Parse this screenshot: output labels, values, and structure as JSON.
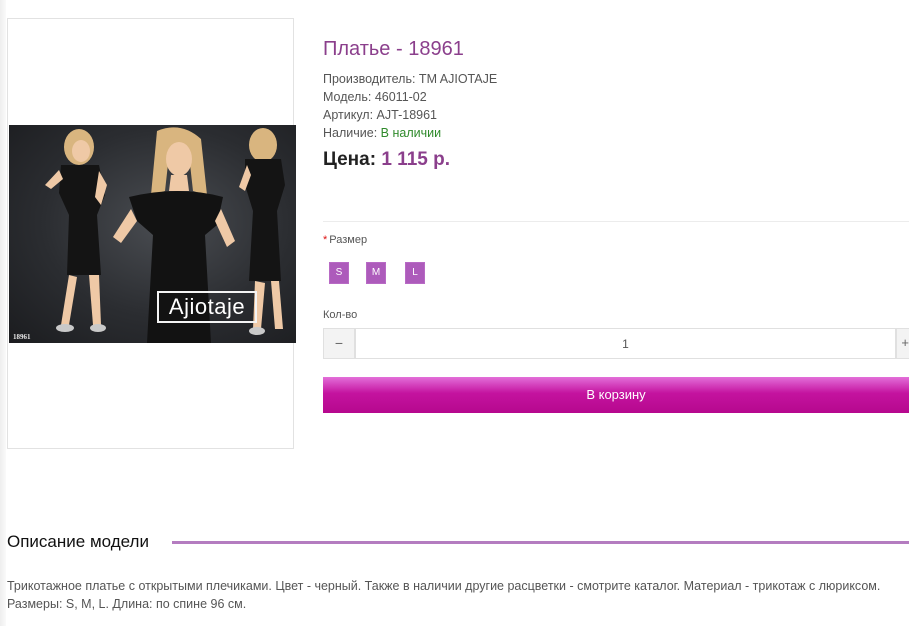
{
  "product": {
    "image": {
      "brand_logo_text": "Ajiotaje",
      "sku_tag": "18961"
    },
    "title": "Платье - 18961",
    "info": {
      "manufacturer": "Производитель: TM AJIOTAJE",
      "model": "Модель: 46011-02",
      "article": "Артикул: AJT-18961",
      "availability_label": "Наличие: ",
      "availability_value": "В наличии"
    },
    "price": {
      "label": "Цена: ",
      "value": "1 115 р."
    }
  },
  "options": {
    "size": {
      "required_mark": "*",
      "label": "Размер",
      "values": [
        "S",
        "M",
        "L"
      ]
    },
    "quantity": {
      "label": "Кол-во",
      "value": "1",
      "minus": "−",
      "plus": "+"
    }
  },
  "actions": {
    "add_to_cart": "В корзину"
  },
  "description": {
    "title": "Описание модели",
    "text": "Трикотажное платье с открытыми плечиками. Цвет - черный. Также в наличии другие расцветки - смотрите каталог. Материал - трикотаж с люриксом. Размеры: S, M, L. Длина: по спине 96 см."
  },
  "colors": {
    "accent": "#8b3f8c",
    "size_button": "#ad5bbb",
    "in_stock": "#2f8a2b",
    "cart_button": "#c4139f",
    "section_line": "#b47cc0"
  }
}
